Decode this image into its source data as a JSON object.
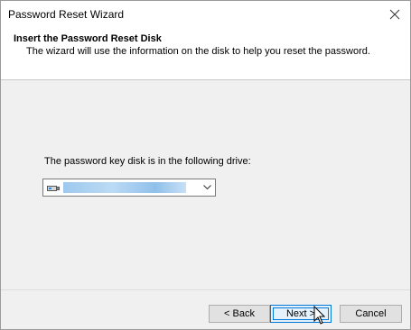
{
  "window": {
    "title": "Password Reset Wizard"
  },
  "header": {
    "title": "Insert the Password Reset Disk",
    "subtitle": "The wizard will use the information on the disk to help you reset the password."
  },
  "body": {
    "drive_label": "The password key disk is in the following drive:",
    "drive_select": {
      "icon": "usb-drive-icon",
      "selected_value": ""
    }
  },
  "buttons": {
    "back_label": "< Back",
    "next_label": "Next >",
    "cancel_label": "Cancel"
  },
  "colors": {
    "accent": "#0078d7",
    "window_bg": "#f0f0f0",
    "header_bg": "#ffffff"
  }
}
